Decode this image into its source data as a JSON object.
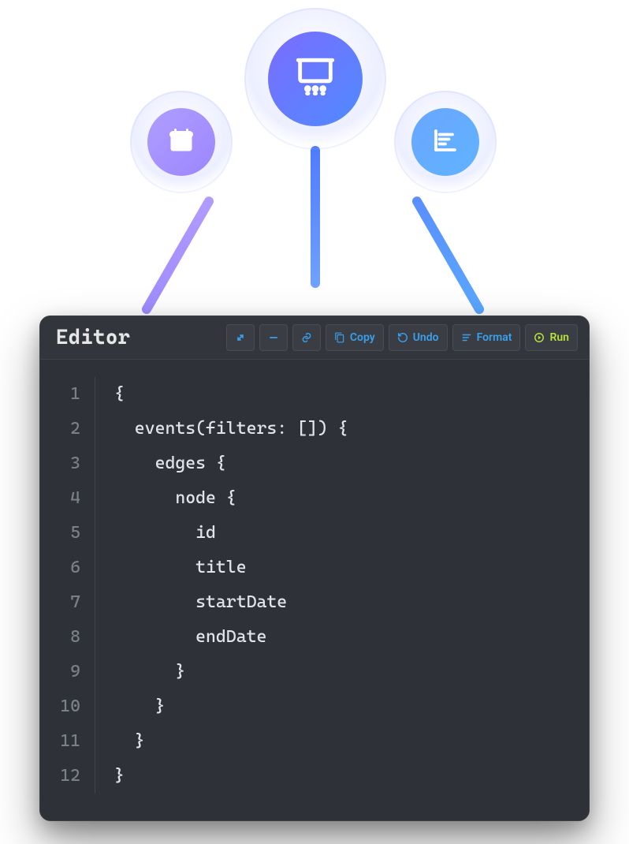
{
  "illustration": {
    "left_icon": "calendar-icon",
    "center_icon": "presentation-icon",
    "right_icon": "gantt-icon"
  },
  "editor": {
    "title": "Editor",
    "toolbar": {
      "expand": {
        "icon": "expand-icon"
      },
      "collapse": {
        "icon": "minus-icon"
      },
      "link": {
        "icon": "link-icon"
      },
      "copy": {
        "label": "Copy",
        "icon": "copy-icon"
      },
      "undo": {
        "label": "Undo",
        "icon": "undo-icon"
      },
      "format": {
        "label": "Format",
        "icon": "format-icon"
      },
      "run": {
        "label": "Run",
        "icon": "play-circle-icon"
      }
    },
    "code_lines": [
      "{",
      "  events(filters: []) {",
      "    edges {",
      "      node {",
      "        id",
      "        title",
      "        startDate",
      "        endDate",
      "      }",
      "    }",
      "  }",
      "}"
    ]
  }
}
